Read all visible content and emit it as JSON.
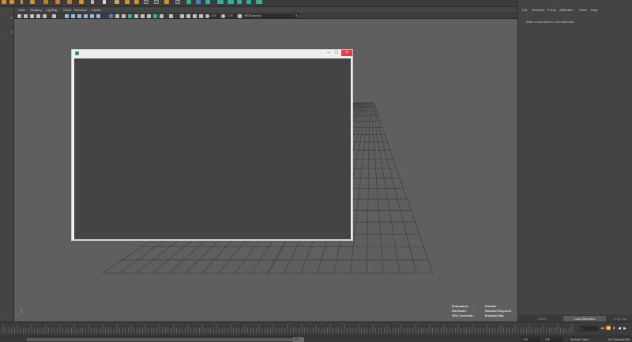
{
  "panel_menu": [
    "View",
    "Shading",
    "Lighting",
    "Show",
    "Renderer",
    "Panels"
  ],
  "panel_toolbar": {
    "field_a": "0.00",
    "field_b": "1.00",
    "colorspace": "sRGB gamma"
  },
  "viewport_hud": [
    {
      "key": "Evaluation:",
      "value": "Parallel"
    },
    {
      "key": "EM Mode:",
      "value": "Rebuild Required"
    },
    {
      "key": "GPU Override:",
      "value": "Enabled 0kb"
    }
  ],
  "right_panel": {
    "menu": [
      "List",
      "Selected",
      "Focus",
      "Attributes",
      "Show",
      "Help"
    ],
    "message": "Make a selection to view attributes",
    "buttons": {
      "select": "Select",
      "load": "Load Attributes",
      "copy": "Copy Tab"
    }
  },
  "time_slider": {
    "current_frame": "1"
  },
  "range_slider": {
    "range_end": "120",
    "start_field": "120",
    "end_field": "200",
    "anim_layer": "No Anim Layer",
    "char_set": "No Character Set"
  },
  "colors": {
    "accent_orange": "#d99029",
    "accent_teal": "#2db39a",
    "accent_blue": "#3a86c8",
    "close_red": "#e04343",
    "grid_line": "#3a3a3a"
  }
}
